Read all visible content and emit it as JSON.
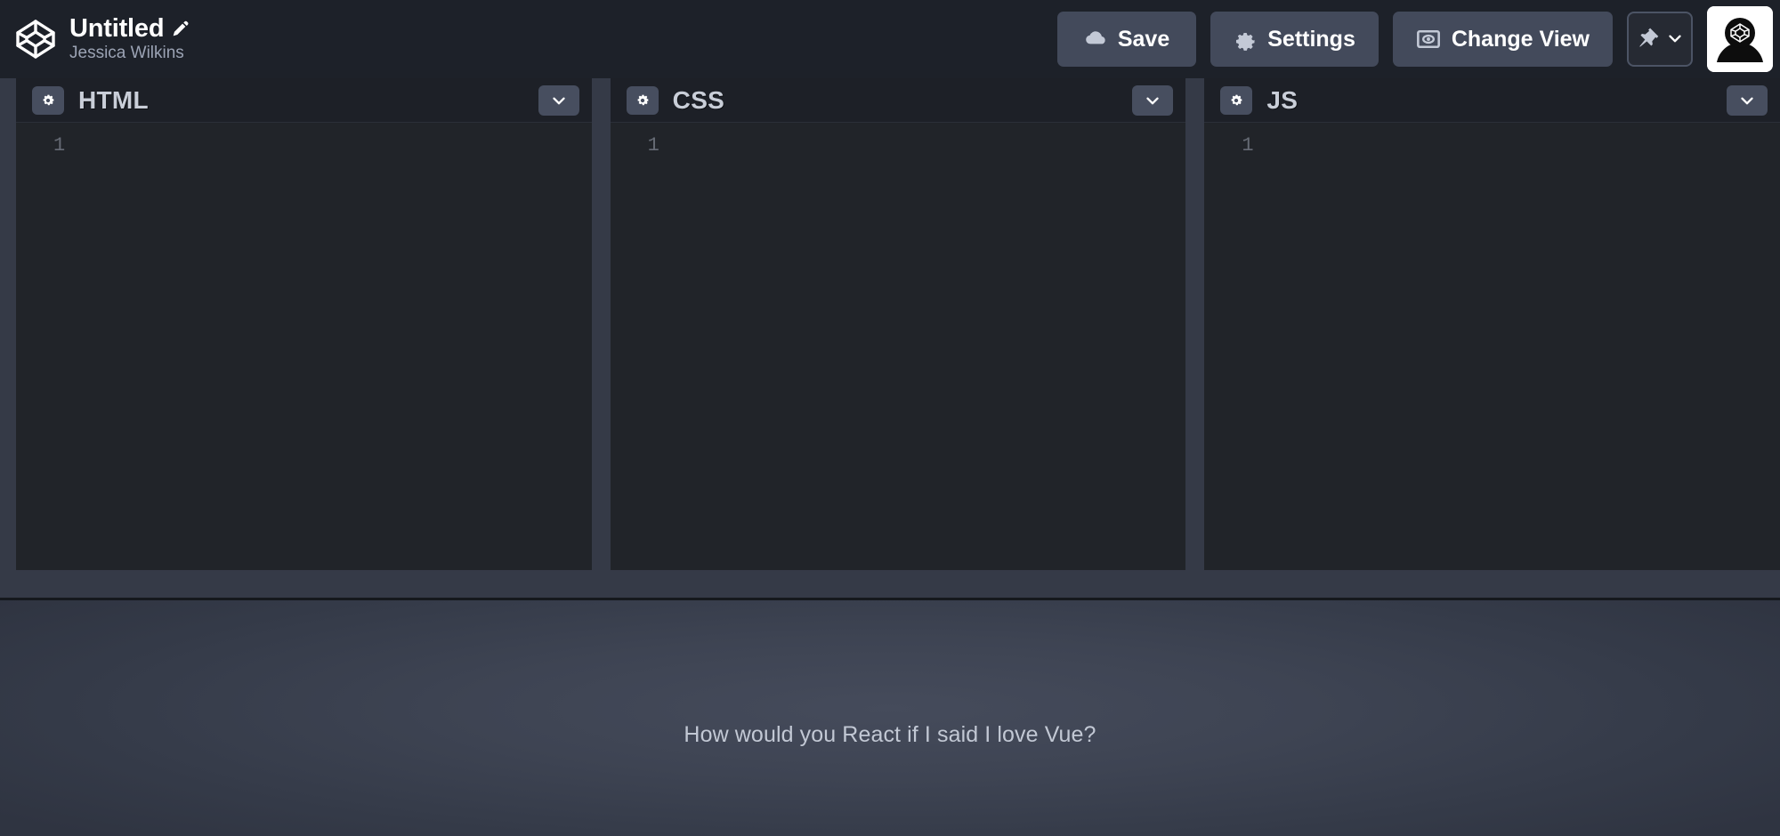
{
  "topbar": {
    "logo_icon": "codepen-logo-icon",
    "pen_title": "Untitled",
    "edit_icon": "pencil-edit-icon",
    "author": "Jessica Wilkins",
    "buttons": {
      "save": {
        "label": "Save",
        "icon": "cloud-icon"
      },
      "settings": {
        "label": "Settings",
        "icon": "gear-icon"
      },
      "change_view": {
        "label": "Change View",
        "icon": "screen-eye-icon"
      },
      "pin": {
        "icon": "pushpin-icon",
        "chevron": "chevron-down-icon"
      },
      "avatar": {
        "icon": "user-avatar-codepen-icon"
      }
    }
  },
  "editors": [
    {
      "id": "html",
      "label": "HTML",
      "settings_icon": "gear-icon",
      "collapse_icon": "chevron-down-icon",
      "line_number": "1",
      "content": ""
    },
    {
      "id": "css",
      "label": "CSS",
      "settings_icon": "gear-icon",
      "collapse_icon": "chevron-down-icon",
      "line_number": "1",
      "content": ""
    },
    {
      "id": "js",
      "label": "JS",
      "settings_icon": "gear-icon",
      "collapse_icon": "chevron-down-icon",
      "line_number": "1",
      "content": ""
    }
  ],
  "preview": {
    "text": "How would you React if I said I love Vue?"
  },
  "colors": {
    "topbar_bg": "#1d2129",
    "panel_header_bg": "#1d2027",
    "panel_body_bg": "#212429",
    "divider": "#353a47",
    "button_bg": "#434a5b",
    "label_text": "#c9ced8",
    "author_text": "#9ba3b4",
    "preview_text": "#c2c8d4"
  }
}
